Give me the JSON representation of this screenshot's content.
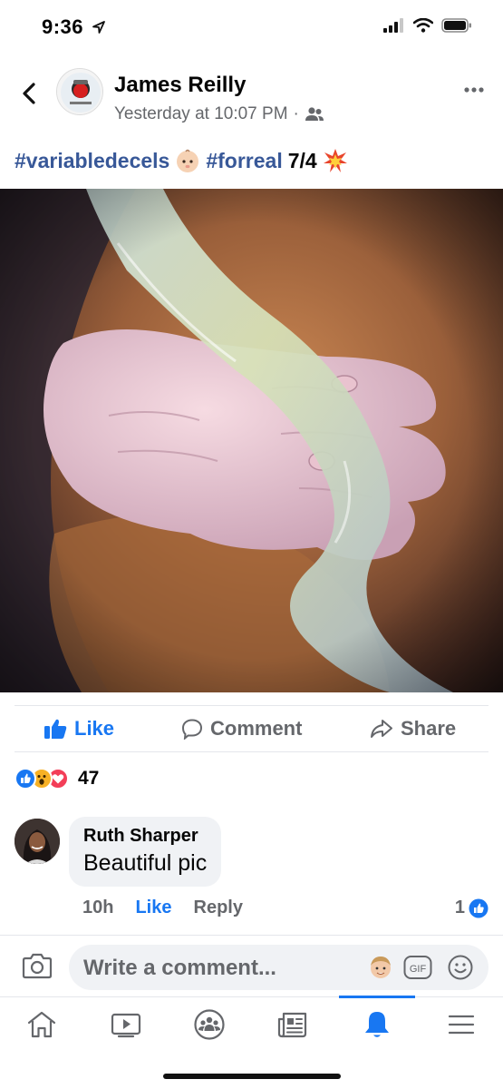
{
  "status_bar": {
    "time": "9:36"
  },
  "post": {
    "author": "James Reilly",
    "timestamp": "Yesterday at 10:07 PM",
    "separator": "·",
    "audience_icon": "friends-icon",
    "caption": {
      "tag1": "#variabledecels",
      "tag2": "#forreal",
      "text": "7/4"
    }
  },
  "actions": {
    "like": "Like",
    "comment": "Comment",
    "share": "Share"
  },
  "reactions": {
    "count": "47",
    "types": [
      "like",
      "wow",
      "love"
    ]
  },
  "comment": {
    "author": "Ruth Sharper",
    "text": "Beautiful pic",
    "time": "10h",
    "like": "Like",
    "reply": "Reply",
    "reaction_count": "1"
  },
  "composer": {
    "placeholder": "Write a comment...",
    "gif": "GIF"
  },
  "tab_bar": {
    "items": [
      "home-icon",
      "watch-icon",
      "groups-icon",
      "news-icon",
      "notifications-icon",
      "menu-icon"
    ],
    "active": "notifications-icon"
  },
  "colors": {
    "brand": "#1877f2",
    "hashtag": "#385898",
    "muted": "#65676b"
  }
}
